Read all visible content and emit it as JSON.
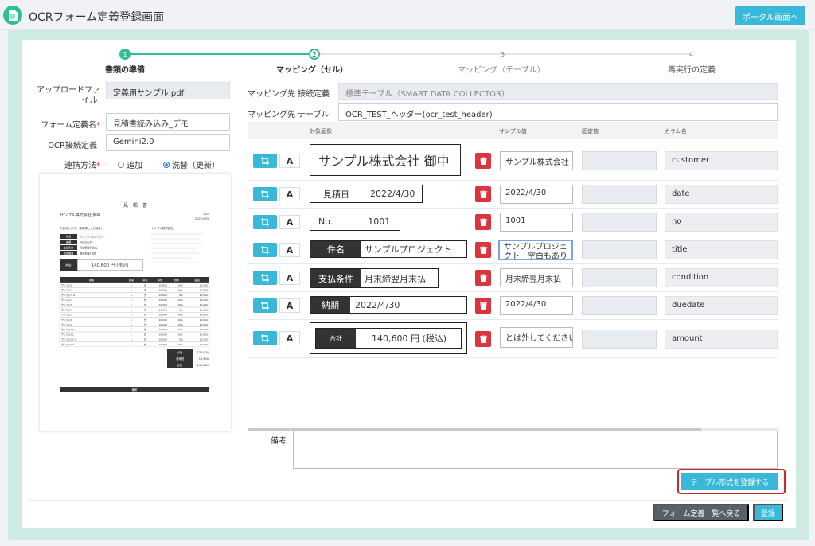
{
  "header": {
    "title": "OCRフォーム定義登録画面",
    "portal_button": "ポータル画面へ"
  },
  "steps": [
    {
      "num": "1",
      "label": "書類の準備",
      "state": "done"
    },
    {
      "num": "2",
      "label": "マッピング（セル）",
      "state": "current"
    },
    {
      "num": "3",
      "label": "マッピング（テーブル）",
      "state": "todo"
    },
    {
      "num": "4",
      "label": "再実行の定義",
      "state": "todo"
    }
  ],
  "form": {
    "upload_label": "アップロードファイル:",
    "upload_value": "定義用サンプル.pdf",
    "name_label": "フォーム定義名",
    "name_value": "見積書読み込み_デモ",
    "ocr_label": "OCR接続定義",
    "ocr_value": "Gemini2.0",
    "link_label": "連携方法",
    "link_option_add": "追加",
    "link_option_replace": "洗替（更新）",
    "link_selected": "replace"
  },
  "mapping": {
    "dest_def_label": "マッピング先 接続定義",
    "dest_def_value": "標準テーブル（SMART DATA COLLECTOR）",
    "dest_table_label": "マッピング先 テーブル",
    "dest_table_value": "OCR_TEST_ヘッダー(ocr_test_header)",
    "columns": {
      "image": "対象画像",
      "sample": "サンプル値",
      "fixed": "固定値",
      "colname": "カラム名"
    },
    "rows": [
      {
        "snip_label": "",
        "snip_text": "サンプル株式会社 御中",
        "sample": "サンプル株式会社",
        "fixed": "",
        "column": "customer"
      },
      {
        "snip_label": "見積日",
        "snip_text": "2022/4/30",
        "sample": "2022/4/30",
        "fixed": "",
        "column": "date"
      },
      {
        "snip_label": "No.",
        "snip_text": "1001",
        "sample": "1001",
        "fixed": "",
        "column": "no"
      },
      {
        "snip_label": "件名",
        "snip_text": "サンプルプロジェクト",
        "sample": "サンプルプロジェクト　空白もあり",
        "fixed": "",
        "column": "title"
      },
      {
        "snip_label": "支払条件",
        "snip_text": "月末締翌月末払",
        "sample": "月末締翌月末払",
        "fixed": "",
        "column": "condition"
      },
      {
        "snip_label": "納期",
        "snip_text": "2022/4/30",
        "sample": "2022/4/30",
        "fixed": "",
        "column": "duedate"
      },
      {
        "snip_label": "合計",
        "snip_text": "140,600 円 (税込)",
        "sample": "とは外してください",
        "fixed": "",
        "column": "amount"
      }
    ]
  },
  "remarks_label": "備考",
  "buttons": {
    "register_table": "テーブル形式を登録する",
    "back": "フォーム定義一覧へ戻る",
    "save": "登録"
  },
  "preview": {
    "doc_title": "見　積　書",
    "customer": "サンプル株式会社 御中",
    "meta_no": "1001",
    "meta_date": "2022/4/30",
    "greeting": "下記のとおり、御見積し上げます。",
    "company": "ケンブル株式会社",
    "info_rows": [
      {
        "k": "件名",
        "v": "サンプルプロジェクト"
      },
      {
        "k": "納期",
        "v": "2022/4/30"
      },
      {
        "k": "支払条件",
        "v": "月末締翌月末払"
      },
      {
        "k": "有効期限",
        "v": "御見積後1週間"
      }
    ],
    "total_label": "合計",
    "total_value": "140,600 円 (税込)",
    "table_header": [
      "摘要",
      "数量",
      "単位",
      "単価",
      "税率",
      "金額"
    ],
    "table_rows": [
      [
        "サンプル1",
        "1",
        "式",
        "10,000",
        "10%",
        "10,000"
      ],
      [
        "サンプル2",
        "1",
        "式",
        "10,000",
        "10%",
        "10,000"
      ],
      [
        "サンプル3 ※",
        "1",
        "式",
        "10,000",
        "8%",
        "10,000"
      ],
      [
        "サンプル4",
        "1",
        "式",
        "10,000",
        "10%",
        "10,000"
      ],
      [
        "サンプル5",
        "1",
        "式",
        "10,000",
        "10%",
        "10,000"
      ],
      [
        "サンプル6",
        "1",
        "式",
        "10,000",
        "8%",
        "10,000"
      ],
      [
        "サンプル7",
        "1",
        "式",
        "10,000",
        "10%",
        "10,000"
      ],
      [
        "サンプル8",
        "1",
        "式",
        "10,000",
        "10%",
        "10,000"
      ],
      [
        "サンプル9",
        "1",
        "式",
        "10,000",
        "10%",
        "10,000"
      ],
      [
        "サンプル10",
        "1",
        "式",
        "10,000",
        "10%",
        "10,000"
      ],
      [
        "サンプル11",
        "1",
        "式",
        "10,000",
        "10%",
        "10,000"
      ],
      [
        "サンプル12 ※",
        "1",
        "式",
        "10,000",
        "8%",
        "10,000"
      ],
      [
        "サンプル13",
        "1",
        "式",
        "10,000",
        "10%",
        "10,000"
      ]
    ],
    "subtotal_label": "小計",
    "subtotal_value": "130,000",
    "tax_label": "消費税",
    "tax_value": "10,600",
    "grand_label": "合計",
    "grand_value": "140,600",
    "footer_label": "備考"
  }
}
